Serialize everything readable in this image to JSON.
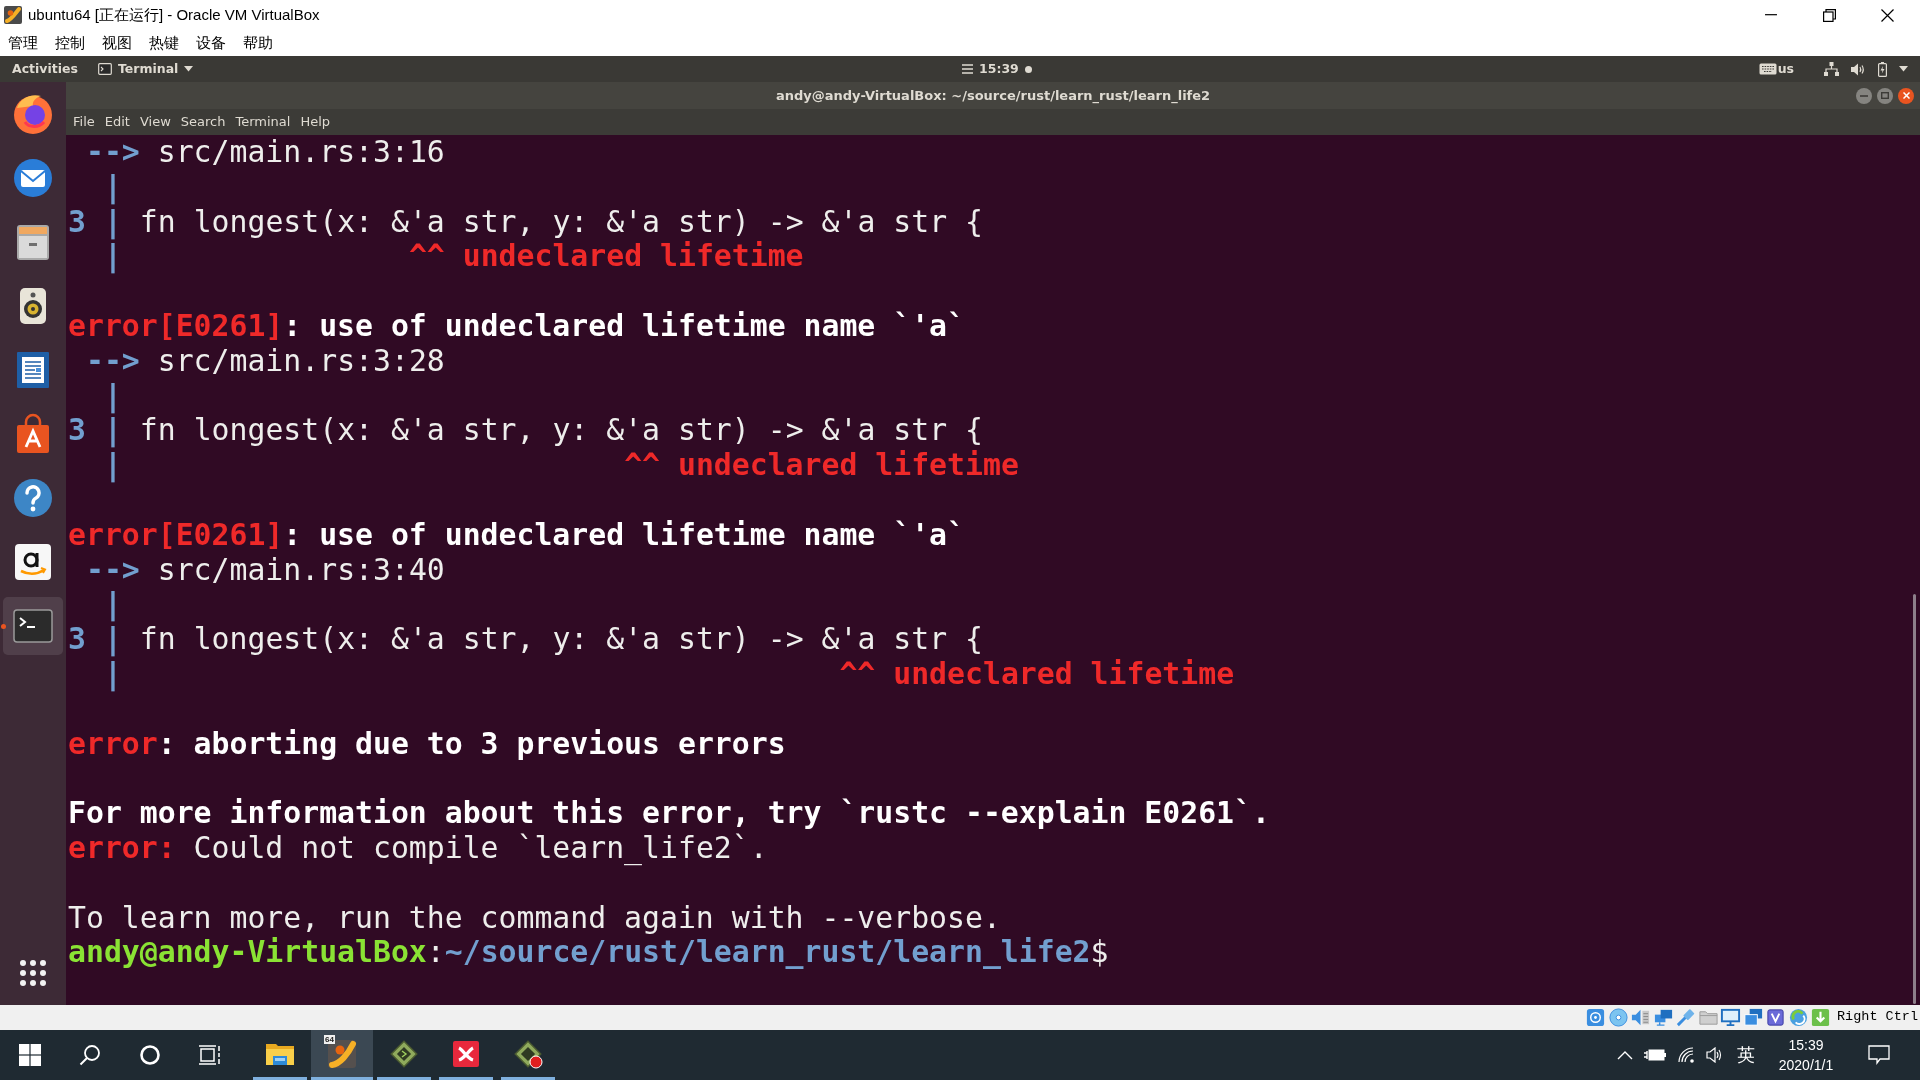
{
  "window": {
    "title": "ubuntu64 [正在运行] - Oracle VM VirtualBox"
  },
  "menu_bar": [
    "管理",
    "控制",
    "视图",
    "热键",
    "设备",
    "帮助"
  ],
  "top_panel": {
    "activities": "Activities",
    "app_menu": "Terminal",
    "clock": "15:39",
    "keyboard_layout": "us"
  },
  "dock": {
    "items": [
      {
        "kind": "firefox",
        "running": false,
        "focused": false
      },
      {
        "kind": "mail",
        "running": false,
        "focused": false
      },
      {
        "kind": "files",
        "running": false,
        "focused": false
      },
      {
        "kind": "music",
        "running": false,
        "focused": false
      },
      {
        "kind": "writer",
        "running": false,
        "focused": false
      },
      {
        "kind": "software",
        "running": false,
        "focused": false
      },
      {
        "kind": "help",
        "running": false,
        "focused": false
      },
      {
        "kind": "amazon",
        "running": false,
        "focused": false
      },
      {
        "kind": "terminal",
        "running": true,
        "focused": true
      }
    ]
  },
  "terminal": {
    "title": "andy@andy-VirtualBox: ~/source/rust/learn_rust/learn_life2",
    "menu": [
      "File",
      "Edit",
      "View",
      "Search",
      "Terminal",
      "Help"
    ],
    "lines": [
      {
        "kind": "text",
        "parts": [
          {
            "kind": "arrow",
            "text": " -->"
          },
          {
            "kind": "location",
            "text": " src/main.rs:3:16"
          }
        ]
      },
      {
        "kind": "text",
        "parts": [
          {
            "kind": "bar",
            "text": "  |"
          }
        ]
      },
      {
        "kind": "text",
        "parts": [
          {
            "kind": "line_number",
            "text": "3"
          },
          {
            "kind": "bar",
            "text": " |"
          },
          {
            "kind": "code",
            "text": " fn longest(x: &'a str, y: &'a str) -> &'a str {"
          }
        ]
      },
      {
        "kind": "text",
        "parts": [
          {
            "kind": "bar",
            "text": "  |"
          },
          {
            "kind": "annotation",
            "text": "                ^^ undeclared lifetime"
          }
        ]
      },
      {
        "kind": "blank"
      },
      {
        "kind": "text",
        "parts": [
          {
            "kind": "message",
            "spans": [
              {
                "kind": "error",
                "text": "error[E0261]"
              },
              {
                "kind": "bold",
                "text": ": use of undeclared lifetime name `'a`"
              }
            ]
          }
        ]
      },
      {
        "kind": "text",
        "parts": [
          {
            "kind": "arrow",
            "text": " -->"
          },
          {
            "kind": "location",
            "text": " src/main.rs:3:28"
          }
        ]
      },
      {
        "kind": "text",
        "parts": [
          {
            "kind": "bar",
            "text": "  |"
          }
        ]
      },
      {
        "kind": "text",
        "parts": [
          {
            "kind": "line_number",
            "text": "3"
          },
          {
            "kind": "bar",
            "text": " |"
          },
          {
            "kind": "code",
            "text": " fn longest(x: &'a str, y: &'a str) -> &'a str {"
          }
        ]
      },
      {
        "kind": "text",
        "parts": [
          {
            "kind": "bar",
            "text": "  |"
          },
          {
            "kind": "annotation",
            "text": "                            ^^ undeclared lifetime"
          }
        ]
      },
      {
        "kind": "blank"
      },
      {
        "kind": "text",
        "parts": [
          {
            "kind": "message",
            "spans": [
              {
                "kind": "error",
                "text": "error[E0261]"
              },
              {
                "kind": "bold",
                "text": ": use of undeclared lifetime name `'a`"
              }
            ]
          }
        ]
      },
      {
        "kind": "text",
        "parts": [
          {
            "kind": "arrow",
            "text": " -->"
          },
          {
            "kind": "location",
            "text": " src/main.rs:3:40"
          }
        ]
      },
      {
        "kind": "text",
        "parts": [
          {
            "kind": "bar",
            "text": "  |"
          }
        ]
      },
      {
        "kind": "text",
        "parts": [
          {
            "kind": "line_number",
            "text": "3"
          },
          {
            "kind": "bar",
            "text": " |"
          },
          {
            "kind": "code",
            "text": " fn longest(x: &'a str, y: &'a str) -> &'a str {"
          }
        ]
      },
      {
        "kind": "text",
        "parts": [
          {
            "kind": "bar",
            "text": "  |"
          },
          {
            "kind": "annotation",
            "text": "                                        ^^ undeclared lifetime"
          }
        ]
      },
      {
        "kind": "blank"
      },
      {
        "kind": "text",
        "parts": [
          {
            "kind": "message",
            "spans": [
              {
                "kind": "error",
                "text": "error"
              },
              {
                "kind": "bold",
                "text": ": aborting due to 3 previous errors"
              }
            ]
          }
        ]
      },
      {
        "kind": "blank"
      },
      {
        "kind": "text",
        "parts": [
          {
            "kind": "message",
            "spans": [
              {
                "kind": "bold",
                "text": "For more information about this error, try `rustc --explain E0261`."
              }
            ]
          }
        ]
      },
      {
        "kind": "text",
        "parts": [
          {
            "kind": "message",
            "spans": [
              {
                "kind": "error",
                "text": "error:"
              },
              {
                "kind": "plain",
                "text": " Could not compile `learn_life2`."
              }
            ]
          }
        ]
      },
      {
        "kind": "blank"
      },
      {
        "kind": "text",
        "parts": [
          {
            "kind": "message",
            "spans": [
              {
                "kind": "plain",
                "text": "To learn more, run the command again with --verbose."
              }
            ]
          }
        ]
      },
      {
        "kind": "text",
        "parts": [
          {
            "kind": "prompt",
            "spans": [
              {
                "kind": "user",
                "text": "andy@andy-VirtualBox"
              },
              {
                "kind": "plain",
                "text": ":"
              },
              {
                "kind": "path",
                "text": "~/source/rust/learn_rust/learn_life2"
              },
              {
                "kind": "plain",
                "text": "$"
              }
            ]
          }
        ]
      }
    ]
  },
  "status_bar": {
    "host_key": "Right Ctrl"
  },
  "taskbar": {
    "apps": [
      {
        "kind": "folder",
        "running": true,
        "active": false
      },
      {
        "kind": "virtualbox",
        "running": true,
        "active": true,
        "badge": "64"
      },
      {
        "kind": "cube",
        "running": true,
        "active": false
      },
      {
        "kind": "xmind",
        "running": true,
        "active": false
      },
      {
        "kind": "cube_record",
        "running": true,
        "active": false
      }
    ],
    "input_method": "英",
    "time": "15:39",
    "date": "2020/1/1"
  }
}
